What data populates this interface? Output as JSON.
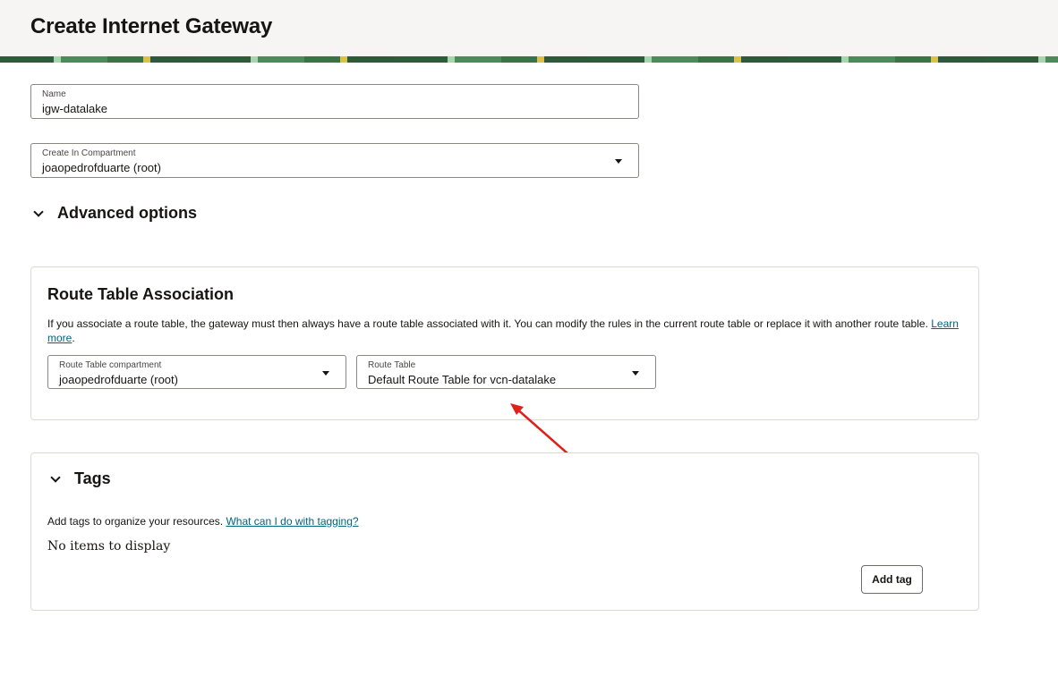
{
  "header": {
    "title": "Create Internet Gateway"
  },
  "form": {
    "name": {
      "label": "Name",
      "value": "igw-datalake"
    },
    "compartment": {
      "label": "Create In Compartment",
      "value": "joaopedrofduarte (root)"
    }
  },
  "advanced": {
    "heading": "Advanced options"
  },
  "route_table_association": {
    "title": "Route Table Association",
    "description": "If you associate a route table, the gateway must then always have a route table associated with it. You can modify the rules in the current route table or replace it with another route table.",
    "learn_more": "Learn more",
    "route_table_compartment": {
      "label": "Route Table compartment",
      "value": "joaopedrofduarte (root)"
    },
    "route_table": {
      "label": "Route Table",
      "value": "Default Route Table for vcn-datalake"
    }
  },
  "tags": {
    "heading": "Tags",
    "description": "Add tags to organize your resources.",
    "help_link": "What can I do with tagging?",
    "empty": "No items to display",
    "add_button": "Add tag"
  },
  "icons": {
    "dropdown": "chevron-down-icon",
    "collapse": "chevron-down-icon",
    "annotation": "red-arrow"
  },
  "colors": {
    "accent_link": "#04637c",
    "annotation_arrow": "#e0201b",
    "header_bg": "#f7f5f3"
  }
}
